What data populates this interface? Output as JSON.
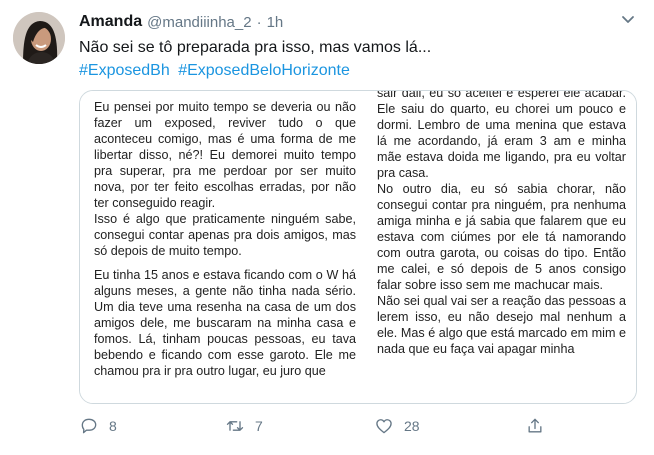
{
  "tweet": {
    "display_name": "Amanda",
    "handle": "@mandiiinha_2",
    "separator": "·",
    "time": "1h",
    "text": "Não sei se tô preparada pra isso, mas vamos lá...",
    "hashtags": [
      "#ExposedBh",
      "#ExposedBeloHorizonte"
    ]
  },
  "document": {
    "left_paragraphs": [
      "Eu pensei por muito tempo se deveria ou não fazer um exposed, reviver tudo o que aconteceu comigo, mas é uma forma de me libertar disso, né?! Eu demorei muito tempo pra superar, pra me perdoar por ser muito nova, por ter feito escolhas erradas, por não ter conseguido reagir.",
      "Isso é algo que praticamente ninguém sabe, consegui contar apenas pra dois amigos, mas só depois de muito tempo.",
      "Eu tinha 15 anos e estava ficando com o W há alguns meses, a gente não tinha nada sério. Um dia teve uma resenha na casa de um dos amigos dele, me buscaram na minha casa e fomos. Lá, tinham poucas pessoas, eu tava bebendo e ficando com esse garoto. Ele me chamou pra ir pra outro lugar, eu juro que"
    ],
    "right_paragraphs": [
      "sair dali, eu só aceitei e esperei ele acabar. Ele saiu do quarto, eu chorei um pouco e dormi. Lembro de uma menina que estava lá me acordando, já eram 3 am e minha mãe estava doida me ligando, pra eu voltar pra casa.",
      "No outro dia, eu só sabia chorar, não consegui contar pra ninguém, pra nenhuma amiga minha e já sabia que falarem que eu estava com ciúmes por ele tá namorando com outra garota, ou coisas do tipo. Então me calei, e só depois de 5 anos consigo falar sobre isso sem me machucar mais.",
      "Não sei qual vai ser a reação das pessoas a lerem isso, eu não desejo mal nenhum a ele. Mas é algo que está marcado em mim e nada que eu faça vai apagar minha"
    ]
  },
  "actions": {
    "reply_count": "8",
    "retweet_count": "7",
    "like_count": "28"
  },
  "icons": {
    "reply": "reply-icon",
    "retweet": "retweet-icon",
    "like": "heart-icon",
    "share": "share-icon",
    "menu": "chevron-down-icon"
  },
  "colors": {
    "link": "#1b95e0",
    "muted": "#657786",
    "text": "#14171a"
  }
}
